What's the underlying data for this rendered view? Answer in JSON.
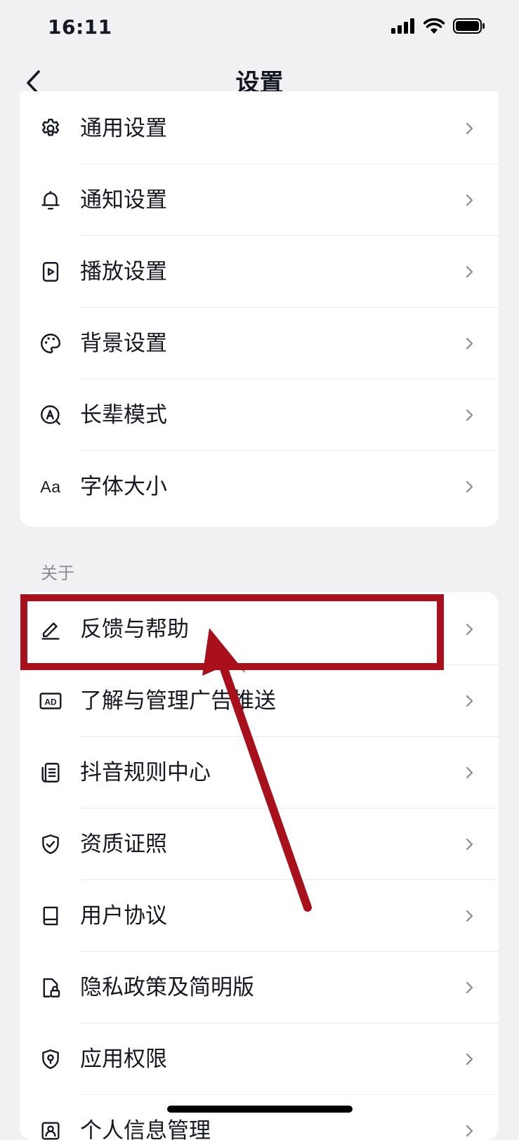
{
  "status_bar": {
    "time": "16:11"
  },
  "nav": {
    "title": "设置"
  },
  "groups": [
    {
      "items": [
        {
          "label": "通用设置",
          "icon": "gear-icon"
        },
        {
          "label": "通知设置",
          "icon": "bell-icon"
        },
        {
          "label": "播放设置",
          "icon": "play-icon"
        },
        {
          "label": "背景设置",
          "icon": "palette-icon"
        },
        {
          "label": "长辈模式",
          "icon": "elder-mode-icon"
        },
        {
          "label": "字体大小",
          "icon": "font-size-icon",
          "icon_text": "Aa"
        }
      ]
    },
    {
      "header": "关于",
      "items": [
        {
          "label": "反馈与帮助",
          "icon": "pencil-icon"
        },
        {
          "label": "了解与管理广告推送",
          "icon": "ad-icon",
          "icon_text": "AD"
        },
        {
          "label": "抖音规则中心",
          "icon": "document-icon"
        },
        {
          "label": "资质证照",
          "icon": "shield-check-icon"
        },
        {
          "label": "用户协议",
          "icon": "book-icon"
        },
        {
          "label": "隐私政策及简明版",
          "icon": "privacy-lock-icon"
        },
        {
          "label": "应用权限",
          "icon": "location-shield-icon"
        },
        {
          "label": "个人信息管理",
          "icon": "person-info-icon"
        }
      ]
    }
  ],
  "annotation": {
    "color": "#a8101b",
    "highlighted_item": "反馈与帮助"
  }
}
